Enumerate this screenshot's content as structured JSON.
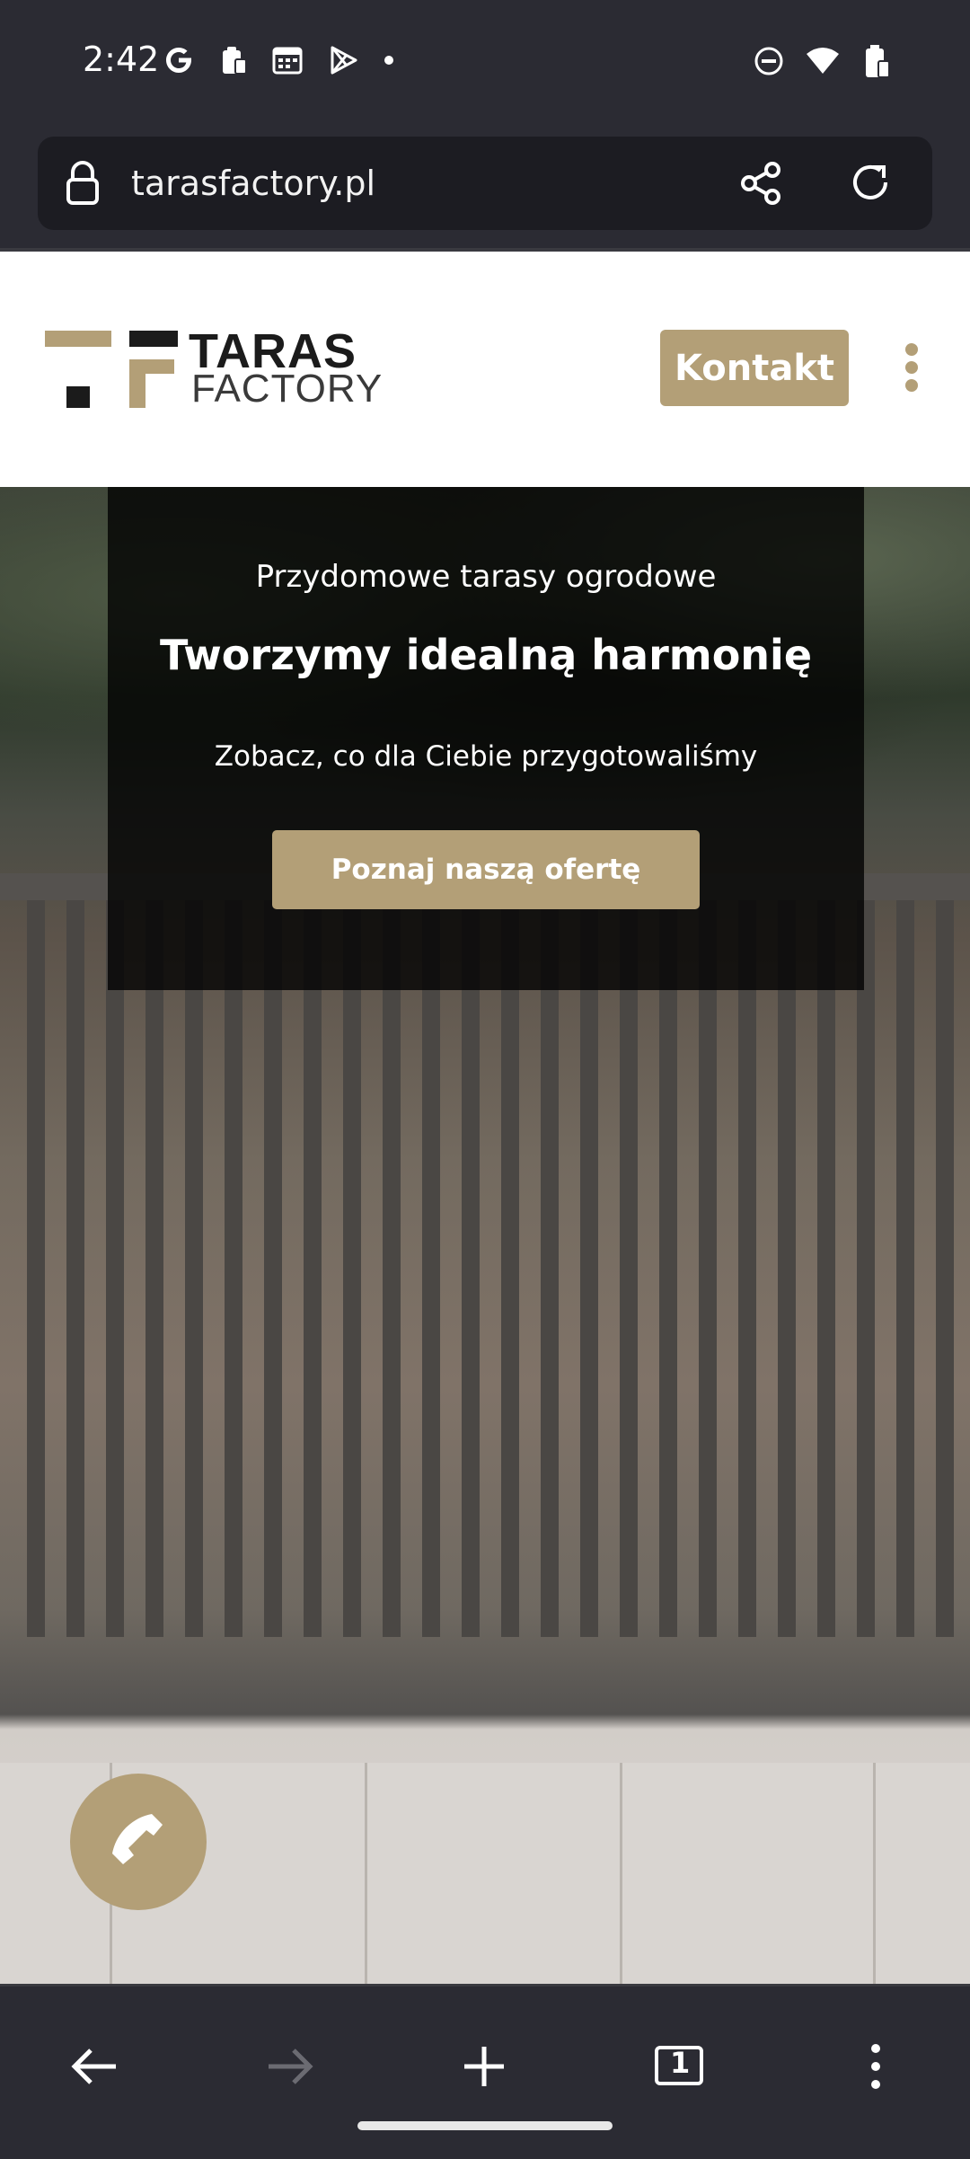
{
  "status_bar": {
    "time": "2:42",
    "left_icons": [
      "google-icon",
      "clipboard-icon",
      "calendar-icon",
      "play-store-icon",
      "dot-icon"
    ],
    "right_icons": [
      "do-not-disturb-icon",
      "wifi-icon",
      "battery-icon"
    ]
  },
  "browser": {
    "url": "tarasfactory.pl",
    "icons": [
      "lock-icon",
      "share-icon",
      "reload-icon"
    ]
  },
  "site_header": {
    "logo_line1": "TARAS",
    "logo_line2": "FACTORY",
    "contact_button": "Kontakt",
    "colors": {
      "accent": "#b39f77",
      "dark": "#1b1b1b"
    }
  },
  "hero": {
    "subtitle": "Przydomowe tarasy ogrodowe",
    "title": "Tworzymy idealną harmonię",
    "description": "Zobacz, co dla Ciebie przygotowaliśmy",
    "cta_button": "Poznaj naszą ofertę"
  },
  "floating": {
    "call_icon": "phone-icon"
  },
  "bottom_nav": {
    "items": [
      "back-icon",
      "forward-icon",
      "new-tab-icon",
      "tabs-icon",
      "more-icon"
    ],
    "tab_count": "1"
  }
}
